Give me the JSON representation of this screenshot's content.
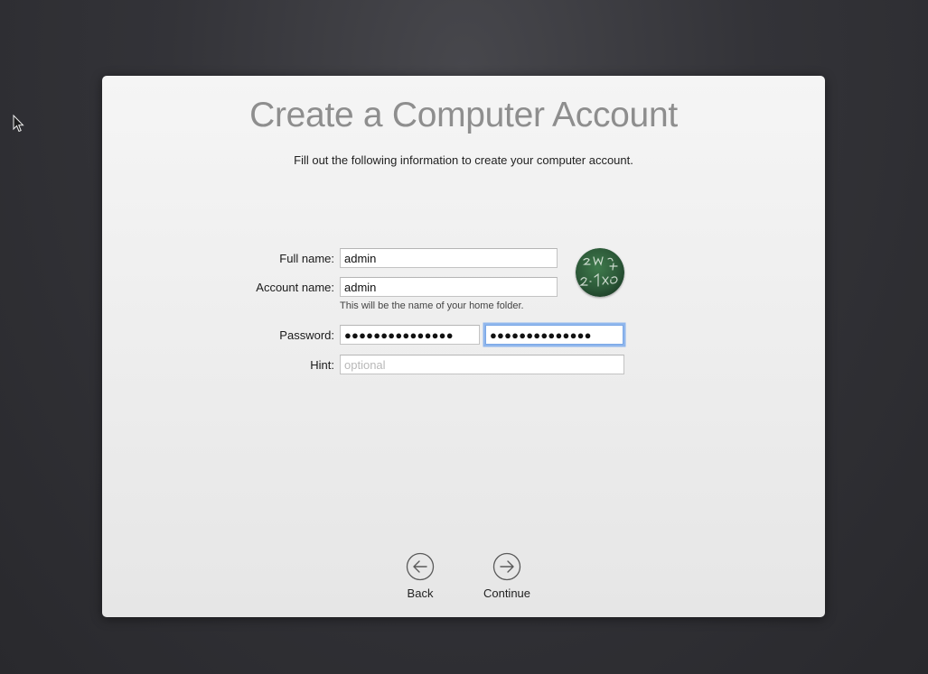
{
  "title": "Create a Computer Account",
  "subtitle": "Fill out the following information to create your computer account.",
  "form": {
    "full_name_label": "Full name:",
    "full_name_value": "admin",
    "account_name_label": "Account name:",
    "account_name_value": "admin",
    "account_name_help": "This will be the name of your home folder.",
    "password_label": "Password:",
    "password_value": "●●●●●●●●●●●●●●●",
    "verify_value": "●●●●●●●●●●●●●●",
    "hint_label": "Hint:",
    "hint_placeholder": "optional"
  },
  "nav": {
    "back_label": "Back",
    "continue_label": "Continue"
  },
  "icons": {
    "cursor": "arrow-cursor-icon",
    "back": "arrow-left-circle-icon",
    "continue": "arrow-right-circle-icon",
    "avatar": "chalkboard-avatar"
  },
  "colors": {
    "focus_ring": "#70a4ec",
    "title": "#8e8e8e",
    "avatar_green": "#2d5a38"
  }
}
